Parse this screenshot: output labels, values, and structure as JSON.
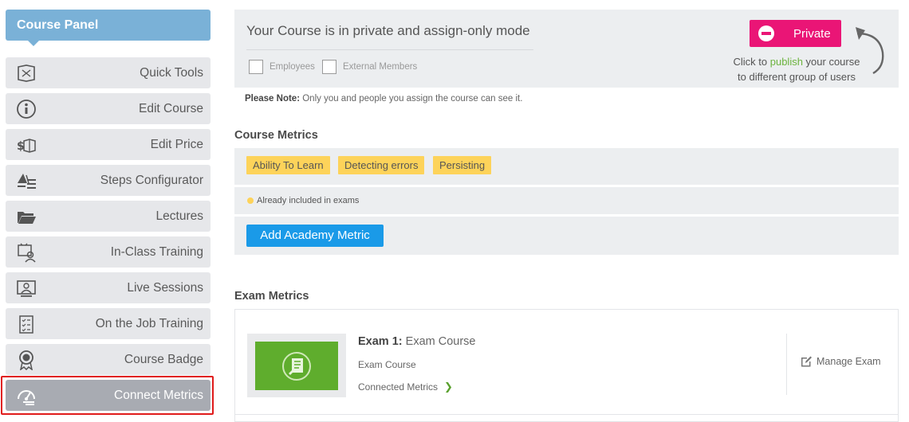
{
  "sidebar": {
    "title": "Course Panel",
    "items": [
      {
        "label": "Quick Tools",
        "icon": "book-icon"
      },
      {
        "label": "Edit Course",
        "icon": "info-icon"
      },
      {
        "label": "Edit Price",
        "icon": "price-book-icon"
      },
      {
        "label": "Steps Configurator",
        "icon": "steps-icon"
      },
      {
        "label": "Lectures",
        "icon": "folder-icon"
      },
      {
        "label": "In-Class Training",
        "icon": "classroom-icon"
      },
      {
        "label": "Live Sessions",
        "icon": "live-screen-icon"
      },
      {
        "label": "On the Job Training",
        "icon": "checklist-icon"
      },
      {
        "label": "Course Badge",
        "icon": "badge-icon"
      },
      {
        "label": "Connect Metrics",
        "icon": "gauge-icon",
        "active": true
      }
    ]
  },
  "privacy": {
    "title": "Your Course is in private and assign-only mode",
    "checkbox_employees": "Employees",
    "checkbox_external": "External Members",
    "private_button": "Private",
    "hint_before": "Click to ",
    "hint_link": "publish",
    "hint_after": " your course",
    "hint_line2": "to different group of users"
  },
  "note": {
    "label": "Please Note:",
    "text": "Only you and people you assign the course can see it."
  },
  "course_metrics": {
    "title": "Course Metrics",
    "tags": [
      "Ability To Learn",
      "Detecting errors",
      "Persisting"
    ],
    "legend": "Already included in exams",
    "add_button": "Add Academy Metric"
  },
  "exam_metrics": {
    "title": "Exam Metrics",
    "exam_label": "Exam 1:",
    "exam_name": "Exam Course",
    "exam_subtitle": "Exam Course",
    "connected_label": "Connected Metrics",
    "manage_label": "Manage Exam"
  },
  "colors": {
    "accent_blue": "#1a9ae8",
    "header_blue": "#7ab1d7",
    "private_pink": "#ea1576",
    "tag_yellow": "#fdd35a",
    "publish_green": "#6cb33e",
    "highlight_red": "#e01b1b"
  }
}
